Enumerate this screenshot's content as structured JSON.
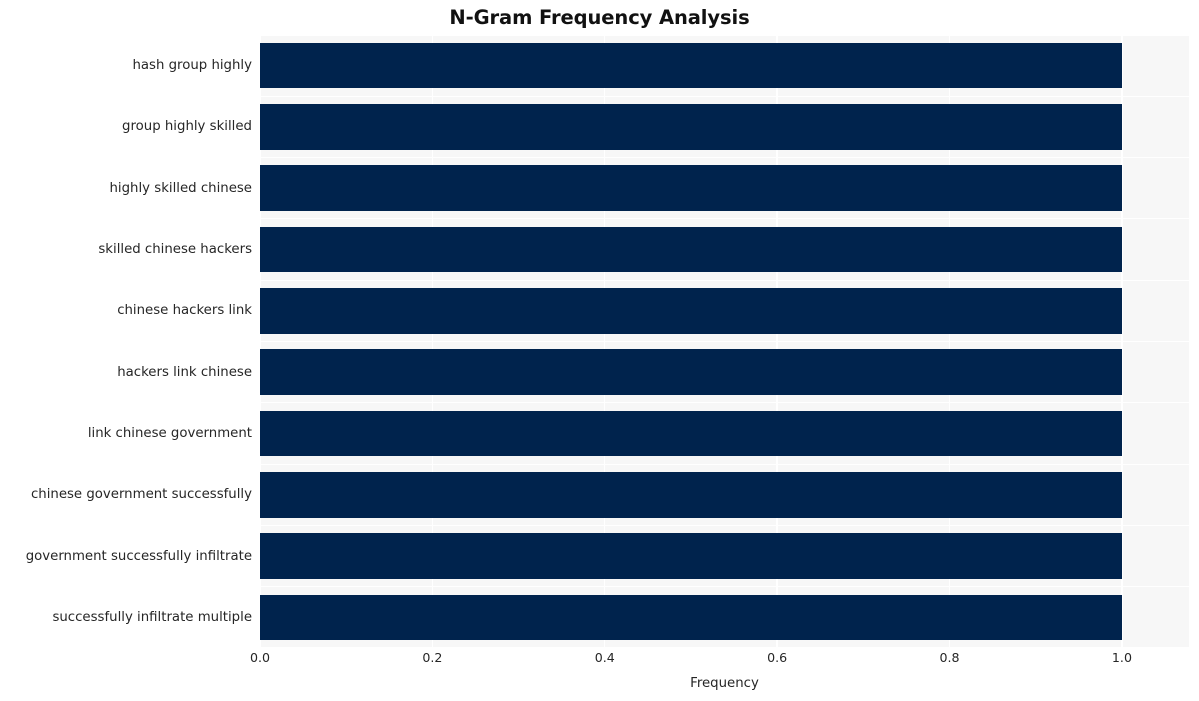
{
  "chart_data": {
    "type": "bar",
    "orientation": "horizontal",
    "title": "N-Gram Frequency Analysis",
    "xlabel": "Frequency",
    "ylabel": "",
    "categories": [
      "hash group highly",
      "group highly skilled",
      "highly skilled chinese",
      "skilled chinese hackers",
      "chinese hackers link",
      "hackers link chinese",
      "link chinese government",
      "chinese government successfully",
      "government successfully infiltrate",
      "successfully infiltrate multiple"
    ],
    "values": [
      1.0,
      1.0,
      1.0,
      1.0,
      1.0,
      1.0,
      1.0,
      1.0,
      1.0,
      1.0
    ],
    "xlim": [
      0.0,
      1.0778
    ],
    "xticks": [
      0.0,
      0.2,
      0.4,
      0.6,
      0.8,
      1.0
    ],
    "xticklabels": [
      "0.0",
      "0.2",
      "0.4",
      "0.6",
      "0.8",
      "1.0"
    ],
    "grid": true,
    "grid_color": "#ffffff",
    "legend": null,
    "bar_color": "#00234d",
    "plot_background": "#f7f7f7",
    "figure_background": "#ffffff",
    "text_color": "#262626"
  }
}
